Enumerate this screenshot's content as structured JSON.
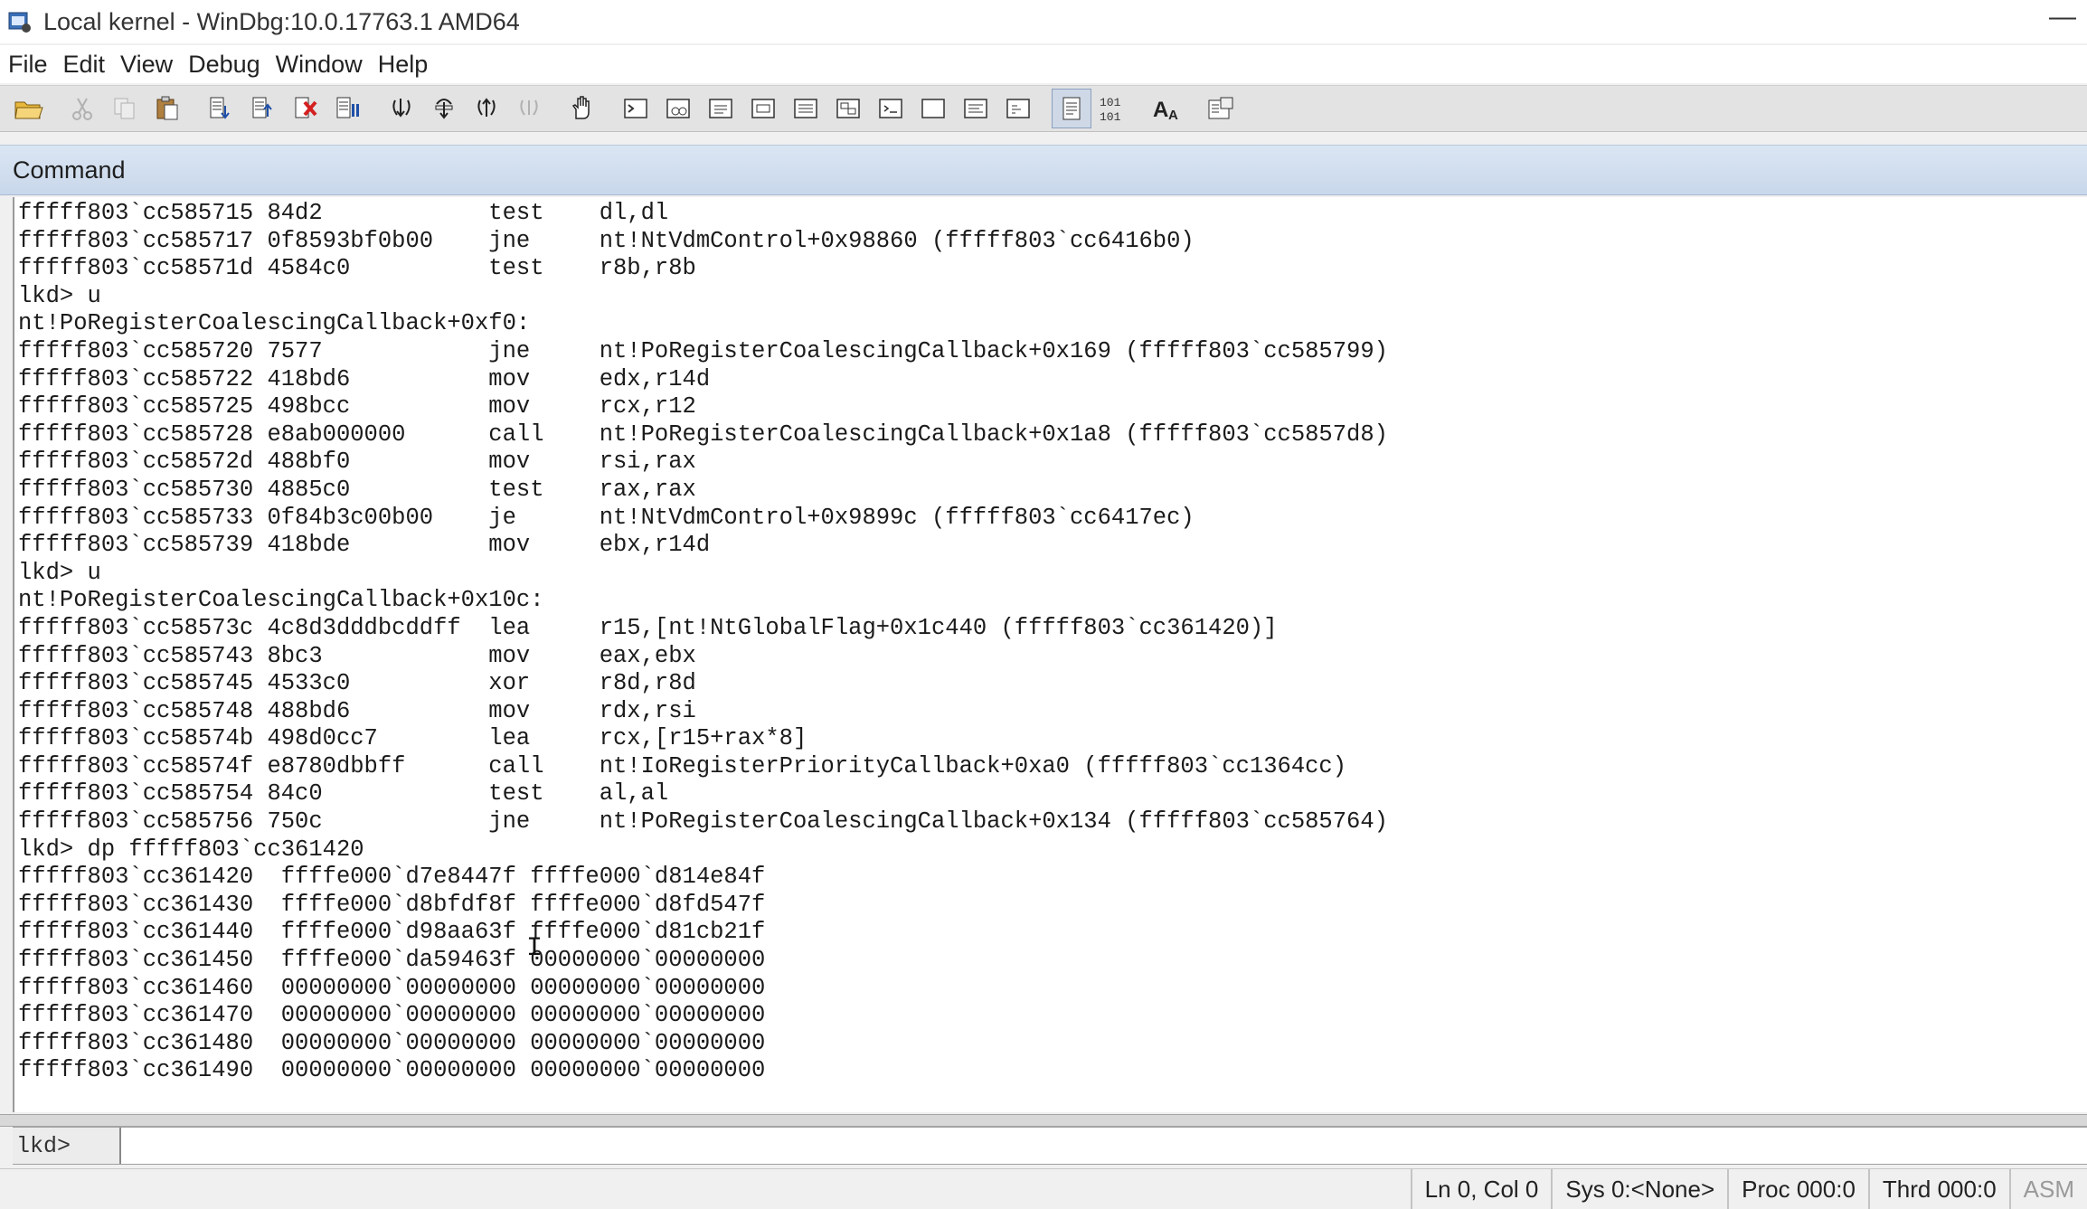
{
  "window": {
    "title": "Local kernel - WinDbg:10.0.17763.1 AMD64",
    "minimize_glyph": "—"
  },
  "menu": [
    "File",
    "Edit",
    "View",
    "Debug",
    "Window",
    "Help"
  ],
  "toolbar": {
    "buttons": [
      {
        "name": "open-icon",
        "enabled": true
      },
      {
        "name": "cut-icon",
        "enabled": false
      },
      {
        "name": "copy-icon",
        "enabled": false
      },
      {
        "name": "paste-icon",
        "enabled": true
      },
      {
        "name": "go-icon",
        "enabled": true
      },
      {
        "name": "restart-icon",
        "enabled": true
      },
      {
        "name": "stop-debugging-icon",
        "enabled": true
      },
      {
        "name": "break-icon",
        "enabled": true
      },
      {
        "name": "step-into-icon",
        "enabled": true
      },
      {
        "name": "step-over-icon",
        "enabled": true
      },
      {
        "name": "step-out-icon",
        "enabled": true
      },
      {
        "name": "run-to-cursor-icon",
        "enabled": false
      },
      {
        "name": "breakpoint-hand-icon",
        "enabled": true
      },
      {
        "name": "command-window-icon",
        "enabled": true
      },
      {
        "name": "watch-window-icon",
        "enabled": true
      },
      {
        "name": "locals-window-icon",
        "enabled": true
      },
      {
        "name": "registers-window-icon",
        "enabled": true
      },
      {
        "name": "memory-window-icon",
        "enabled": true
      },
      {
        "name": "call-stack-window-icon",
        "enabled": true
      },
      {
        "name": "disassembly-window-icon",
        "enabled": true
      },
      {
        "name": "scratch-pad-icon",
        "enabled": true
      },
      {
        "name": "processes-threads-icon",
        "enabled": true
      },
      {
        "name": "source-mode-icon",
        "enabled": true
      },
      {
        "name": "hex-display-icon",
        "enabled": true,
        "label": "101\n101"
      },
      {
        "name": "font-icon",
        "enabled": true,
        "label": "A"
      },
      {
        "name": "options-icon",
        "enabled": true
      }
    ]
  },
  "command_window": {
    "title": "Command",
    "output_lines": [
      "fffff803`cc585715 84d2            test    dl,dl",
      "fffff803`cc585717 0f8593bf0b00    jne     nt!NtVdmControl+0x98860 (fffff803`cc6416b0)",
      "fffff803`cc58571d 4584c0          test    r8b,r8b",
      "lkd> u",
      "nt!PoRegisterCoalescingCallback+0xf0:",
      "fffff803`cc585720 7577            jne     nt!PoRegisterCoalescingCallback+0x169 (fffff803`cc585799)",
      "fffff803`cc585722 418bd6          mov     edx,r14d",
      "fffff803`cc585725 498bcc          mov     rcx,r12",
      "fffff803`cc585728 e8ab000000      call    nt!PoRegisterCoalescingCallback+0x1a8 (fffff803`cc5857d8)",
      "fffff803`cc58572d 488bf0          mov     rsi,rax",
      "fffff803`cc585730 4885c0          test    rax,rax",
      "fffff803`cc585733 0f84b3c00b00    je      nt!NtVdmControl+0x9899c (fffff803`cc6417ec)",
      "fffff803`cc585739 418bde          mov     ebx,r14d",
      "lkd> u",
      "nt!PoRegisterCoalescingCallback+0x10c:",
      "fffff803`cc58573c 4c8d3dddbcddff  lea     r15,[nt!NtGlobalFlag+0x1c440 (fffff803`cc361420)]",
      "fffff803`cc585743 8bc3            mov     eax,ebx",
      "fffff803`cc585745 4533c0          xor     r8d,r8d",
      "fffff803`cc585748 488bd6          mov     rdx,rsi",
      "fffff803`cc58574b 498d0cc7        lea     rcx,[r15+rax*8]",
      "fffff803`cc58574f e8780dbbff      call    nt!IoRegisterPriorityCallback+0xa0 (fffff803`cc1364cc)",
      "fffff803`cc585754 84c0            test    al,al",
      "fffff803`cc585756 750c            jne     nt!PoRegisterCoalescingCallback+0x134 (fffff803`cc585764)",
      "lkd> dp fffff803`cc361420",
      "fffff803`cc361420  ffffe000`d7e8447f ffffe000`d814e84f",
      "fffff803`cc361430  ffffe000`d8bfdf8f ffffe000`d8fd547f",
      "fffff803`cc361440  ffffe000`d98aa63f ffffe000`d81cb21f",
      "fffff803`cc361450  ffffe000`da59463f 00000000`00000000",
      "fffff803`cc361460  00000000`00000000 00000000`00000000",
      "fffff803`cc361470  00000000`00000000 00000000`00000000",
      "fffff803`cc361480  00000000`00000000 00000000`00000000",
      "fffff803`cc361490  00000000`00000000 00000000`00000000"
    ],
    "prompt": "lkd>",
    "input_value": ""
  },
  "status_bar": {
    "position": "Ln 0, Col 0",
    "system": "Sys 0:<None>",
    "process": "Proc 000:0",
    "thread": "Thrd 000:0",
    "asm": "ASM"
  },
  "colors": {
    "header_gradient_top": "#dbe6f4",
    "header_gradient_bottom": "#c8d7ea",
    "toolbar_bg": "#e3e3e3",
    "output_bg": "#ffffff"
  }
}
